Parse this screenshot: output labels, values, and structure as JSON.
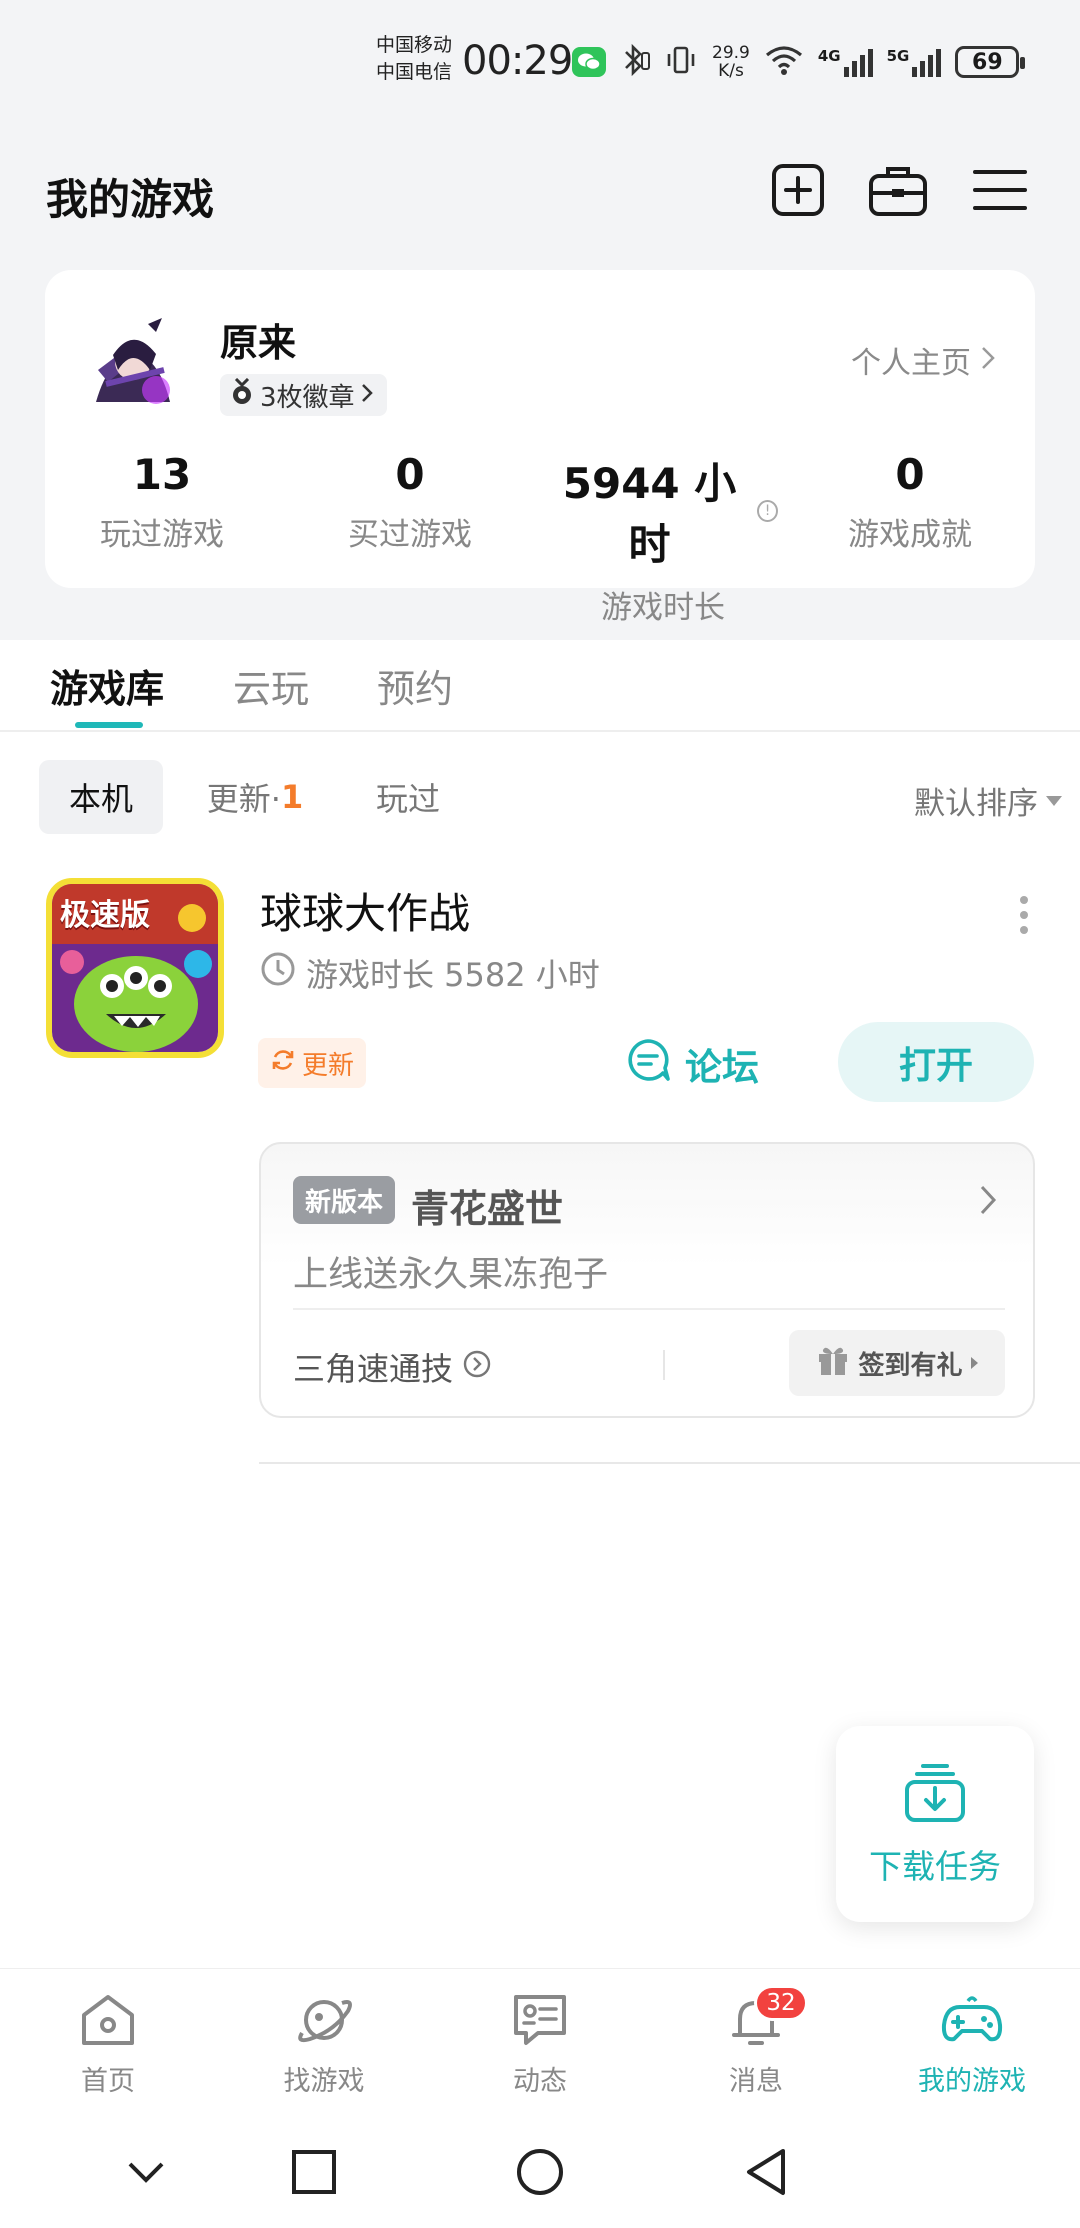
{
  "status_bar": {
    "carrier1": "中国移动",
    "carrier2": "中国电信",
    "time": "00:29",
    "speed_value": "29.9",
    "speed_unit": "K/s",
    "net1": "4G",
    "net2": "5G",
    "battery": "69"
  },
  "header": {
    "title": "我的游戏",
    "icons": [
      "add-icon",
      "toolbox-icon",
      "menu-icon"
    ]
  },
  "profile": {
    "username": "原来",
    "badges_label": "3枚徽章",
    "homepage_link": "个人主页",
    "stats": [
      {
        "value": "13",
        "label": "玩过游戏"
      },
      {
        "value": "0",
        "label": "买过游戏"
      },
      {
        "value": "5944 小时",
        "label": "游戏时长"
      },
      {
        "value": "0",
        "label": "游戏成就"
      }
    ]
  },
  "tabs": [
    "游戏库",
    "云玩",
    "预约"
  ],
  "active_tab": "游戏库",
  "filters": {
    "local": "本机",
    "update_label": "更新·",
    "update_count": "1",
    "played": "玩过",
    "sort": "默认排序"
  },
  "game": {
    "name": "球球大作战",
    "icon_badge": "极速版",
    "playtime": "游戏时长 5582 小时",
    "update_tag": "更新",
    "forum_label": "论坛",
    "open_label": "打开",
    "promo": {
      "tag": "新版本",
      "title": "青花盛世",
      "subtitle": "上线送永久果冻孢子",
      "link": "三角速通技",
      "signin": "签到有礼"
    }
  },
  "download_fab": {
    "label": "下载任务"
  },
  "bottom_nav": [
    {
      "label": "首页",
      "icon": "home-icon"
    },
    {
      "label": "找游戏",
      "icon": "planet-icon"
    },
    {
      "label": "动态",
      "icon": "chat-card-icon"
    },
    {
      "label": "消息",
      "icon": "bell-icon"
    },
    {
      "label": "我的游戏",
      "icon": "gamepad-icon"
    }
  ],
  "messages_badge": "32",
  "colors": {
    "accent": "#1eb3b3",
    "orange": "#f47c2b",
    "badge_red": "#f2423f"
  }
}
